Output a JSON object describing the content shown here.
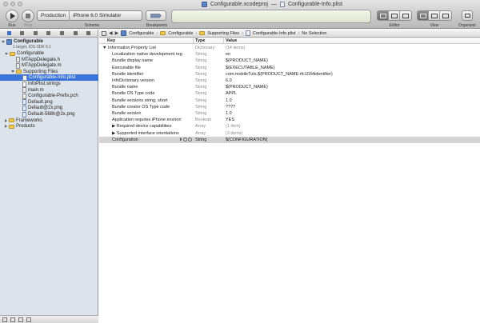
{
  "window": {
    "title_project": "Configurable.xcodeproj",
    "title_separator": "—",
    "title_file": "Configurable-Info.plist"
  },
  "toolbar": {
    "run_label": "Run",
    "stop_label": "Stop",
    "scheme_label": "Scheme",
    "scheme_name": "Production",
    "destination": "iPhone 6.0 Simulator",
    "breakpoints_label": "Breakpoints",
    "editor_label": "Editor",
    "view_label": "View",
    "organizer_label": "Organizer"
  },
  "navigator": {
    "project": {
      "name": "Configurable",
      "subtitle": "1 target, iOS SDK 6.1"
    },
    "items": [
      {
        "label": "Configurable",
        "kind": "folder",
        "level": 1,
        "expanded": true
      },
      {
        "label": "MTAppDelegate.h",
        "kind": "h",
        "level": 2
      },
      {
        "label": "MTAppDelegate.m",
        "kind": "m",
        "level": 2
      },
      {
        "label": "Supporting Files",
        "kind": "folder",
        "level": 2,
        "expanded": true
      },
      {
        "label": "Configurable-Info.plist",
        "kind": "plist",
        "level": 3,
        "selected": true
      },
      {
        "label": "InfoPlist.strings",
        "kind": "strings",
        "level": 3
      },
      {
        "label": "main.m",
        "kind": "m",
        "level": 3
      },
      {
        "label": "Configurable-Prefix.pch",
        "kind": "h",
        "level": 3
      },
      {
        "label": "Default.png",
        "kind": "png",
        "level": 3
      },
      {
        "label": "Default@2x.png",
        "kind": "png",
        "level": 3
      },
      {
        "label": "Default-568h@2x.png",
        "kind": "png",
        "level": 3
      },
      {
        "label": "Frameworks",
        "kind": "folder",
        "level": 1,
        "expanded": false
      },
      {
        "label": "Products",
        "kind": "folder",
        "level": 1,
        "expanded": false
      }
    ]
  },
  "jumpbar": {
    "crumbs": [
      "Configurable",
      "Configurable",
      "Supporting Files",
      "Configurable-Info.plist",
      "No Selection"
    ]
  },
  "plist": {
    "headers": {
      "key": "Key",
      "type": "Type",
      "value": "Value"
    },
    "rows": [
      {
        "key": "▼ Information Property List",
        "type": "Dictionary",
        "value": "(14 items)",
        "indent": 0,
        "value_gray": true
      },
      {
        "key": "Localization native development reg",
        "type": "String",
        "value": "en",
        "indent": 1
      },
      {
        "key": "Bundle display name",
        "type": "String",
        "value": "$(PRODUCT_NAME)",
        "indent": 1
      },
      {
        "key": "Executable file",
        "type": "String",
        "value": "$(EXECUTABLE_NAME)",
        "indent": 1
      },
      {
        "key": "Bundle identifier",
        "type": "String",
        "value": "com.mobileTuts.$(PRODUCT_NAME:rfc1034identifier)",
        "indent": 1
      },
      {
        "key": "InfoDictionary version",
        "type": "String",
        "value": "6.0",
        "indent": 1
      },
      {
        "key": "Bundle name",
        "type": "String",
        "value": "$(PRODUCT_NAME)",
        "indent": 1
      },
      {
        "key": "Bundle OS Type code",
        "type": "String",
        "value": "APPL",
        "indent": 1
      },
      {
        "key": "Bundle versions string, short",
        "type": "String",
        "value": "1.0",
        "indent": 1
      },
      {
        "key": "Bundle creator OS Type code",
        "type": "String",
        "value": "????",
        "indent": 1
      },
      {
        "key": "Bundle version",
        "type": "String",
        "value": "1.0",
        "indent": 1
      },
      {
        "key": "Application requires iPhone environ",
        "type": "Boolean",
        "value": "YES",
        "indent": 1
      },
      {
        "key": "▶ Required device capabilities",
        "type": "Array",
        "value": "(1 item)",
        "indent": 1,
        "value_gray": true
      },
      {
        "key": "▶ Supported interface orientations",
        "type": "Array",
        "value": "(3 items)",
        "indent": 1,
        "value_gray": true
      },
      {
        "key": "Configuration",
        "type": "String",
        "value": "$(CONFIGURATION)",
        "indent": 1,
        "selected": true
      }
    ]
  }
}
